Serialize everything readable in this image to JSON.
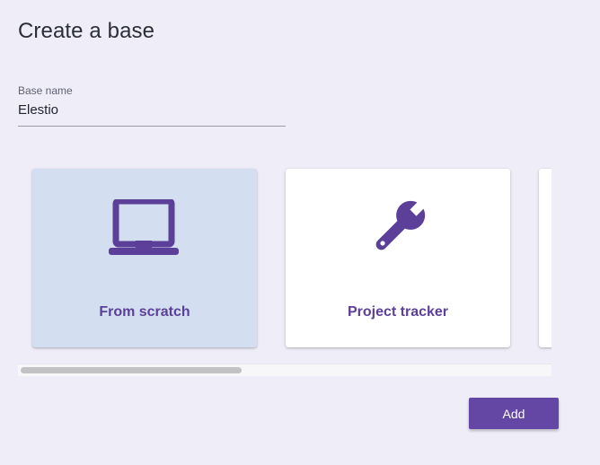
{
  "dialog": {
    "title": "Create a base"
  },
  "base_name_field": {
    "label": "Base name",
    "value": "Elestio"
  },
  "templates": [
    {
      "label": "From scratch",
      "icon": "laptop-icon",
      "selected": true
    },
    {
      "label": "Project tracker",
      "icon": "wrench-icon",
      "selected": false
    }
  ],
  "actions": {
    "add_label": "Add"
  },
  "colors": {
    "accent": "#6446a4",
    "icon": "#5b3f99",
    "selected_card": "#d3dff0",
    "background": "#efedf8"
  }
}
